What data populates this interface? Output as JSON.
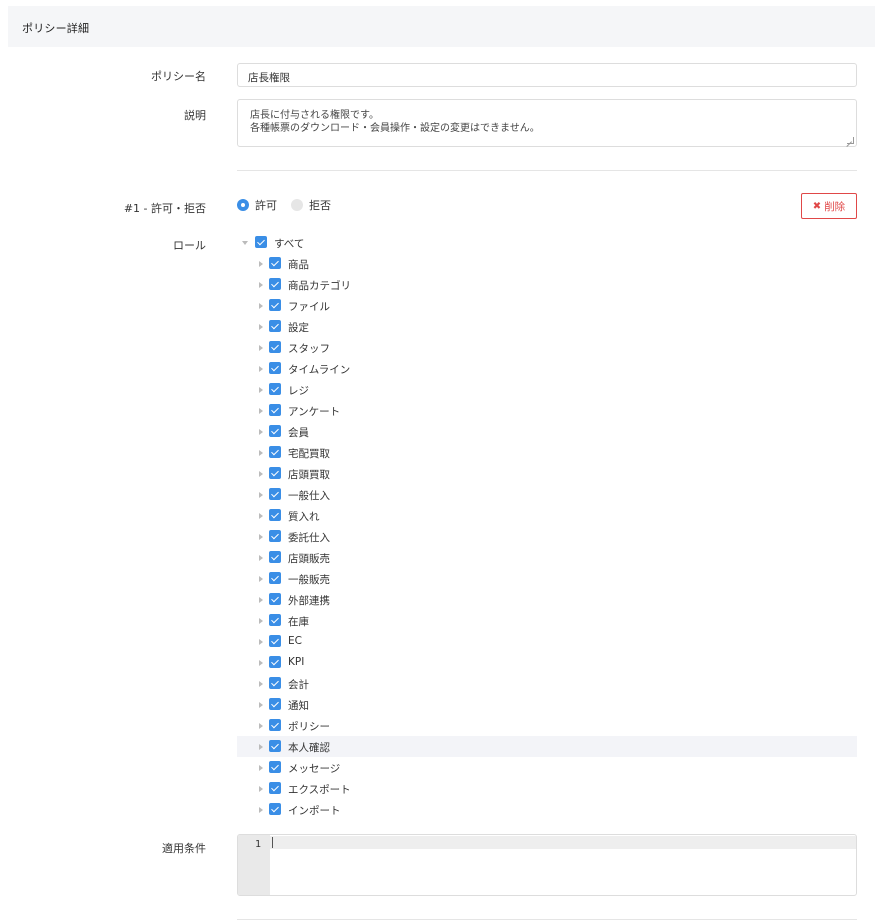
{
  "card": {
    "title": "ポリシー詳細"
  },
  "form": {
    "policy_name_label": "ポリシー名",
    "policy_name_value": "店長権限",
    "description_label": "説明",
    "description_lines": [
      "店長に付与される権限です。",
      "各種帳票のダウンロード・会員操作・設定の変更はできません。"
    ],
    "rule_label": "#1 - 許可・拒否",
    "radio_allow": "許可",
    "radio_deny": "拒否",
    "radio_selected": "許可",
    "delete_button": "削除",
    "role_label": "ロール",
    "condition_label": "適用条件"
  },
  "roles": {
    "root": "すべて",
    "items": [
      "商品",
      "商品カテゴリ",
      "ファイル",
      "設定",
      "スタッフ",
      "タイムライン",
      "レジ",
      "アンケート",
      "会員",
      "宅配買取",
      "店頭買取",
      "一般仕入",
      "質入れ",
      "委託仕入",
      "店頭販売",
      "一般販売",
      "外部連携",
      "在庫",
      "EC",
      "KPI",
      "会計",
      "通知",
      "ポリシー",
      "本人確認",
      "メッセージ",
      "エクスポート",
      "インポート"
    ],
    "highlighted": "本人確認"
  },
  "editor": {
    "line_number": "1"
  },
  "colors": {
    "accent": "#3a8ee6",
    "danger": "#e04848",
    "header_bg": "#f5f6f8"
  },
  "icons": {
    "delete": "close-x-icon",
    "tree_expand": "caret-right-icon",
    "tree_collapse": "caret-down-icon"
  }
}
